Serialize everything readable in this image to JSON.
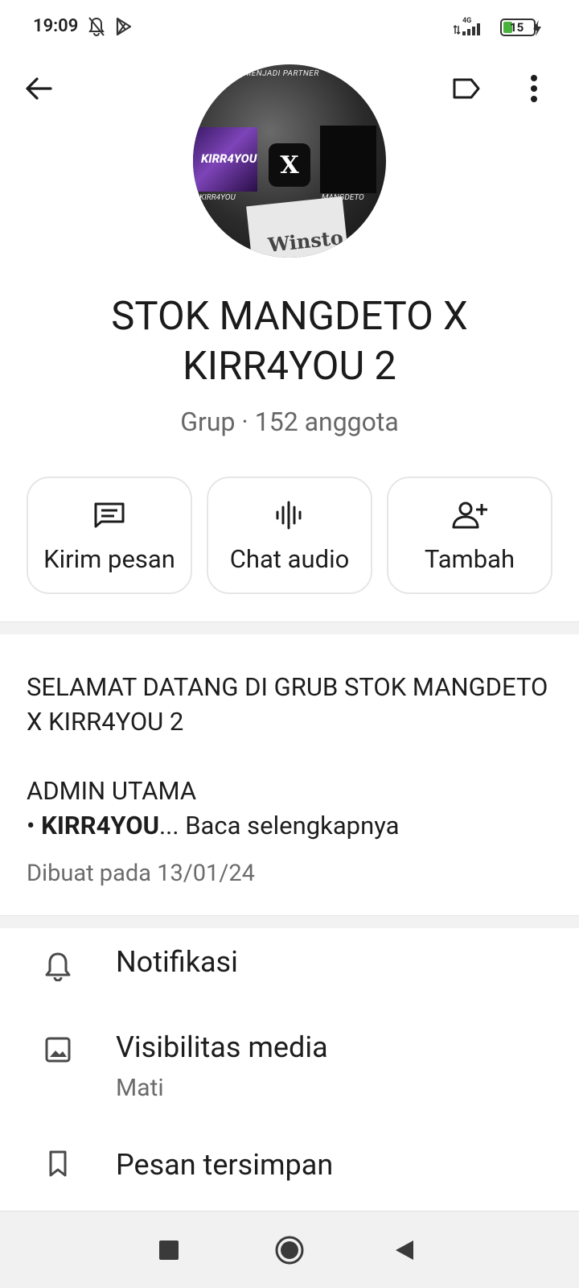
{
  "status_bar": {
    "time": "19:09",
    "network": "4G",
    "battery": "15",
    "icons": [
      "bell-off-icon",
      "play-store-icon",
      "signal-icon",
      "battery-icon",
      "charging-icon"
    ]
  },
  "app_bar": {
    "icons": [
      "back-arrow-icon",
      "label-icon",
      "more-vert-icon"
    ]
  },
  "avatar": {
    "top_text": "RESMI MENJADI PARTNER",
    "left_text": "KIRR4YOU",
    "left_badge": "KIRR4YOU",
    "right_text": "MANGDETO",
    "center_text": "X",
    "pack_text": "Winsto"
  },
  "group": {
    "title": "STOK MANGDETO X KIRR4YOU 2",
    "subtitle": "Grup · 152 anggota"
  },
  "actions": [
    {
      "label": "Kirim pesan",
      "icon": "message-icon"
    },
    {
      "label": "Chat audio",
      "icon": "audio-wave-icon"
    },
    {
      "label": "Tambah",
      "icon": "add-person-icon"
    }
  ],
  "description": {
    "line1": "SELAMAT DATANG DI GRUB STOK MANGDETO X KIRR4YOU 2",
    "line2": "ADMIN UTAMA",
    "bullet": "• ",
    "bold": "KIRR4YOU",
    "more": "... Baca selengkapnya",
    "created": "Dibuat pada 13/01/24"
  },
  "settings": [
    {
      "label": "Notifikasi",
      "icon": "bell-icon"
    },
    {
      "label": "Visibilitas media",
      "sub": "Mati",
      "icon": "image-icon"
    },
    {
      "label": "Pesan tersimpan",
      "icon": "bookmark-icon"
    }
  ],
  "nav_bar": {
    "icons": [
      "recents-square-icon",
      "home-circle-icon",
      "back-triangle-icon"
    ]
  }
}
